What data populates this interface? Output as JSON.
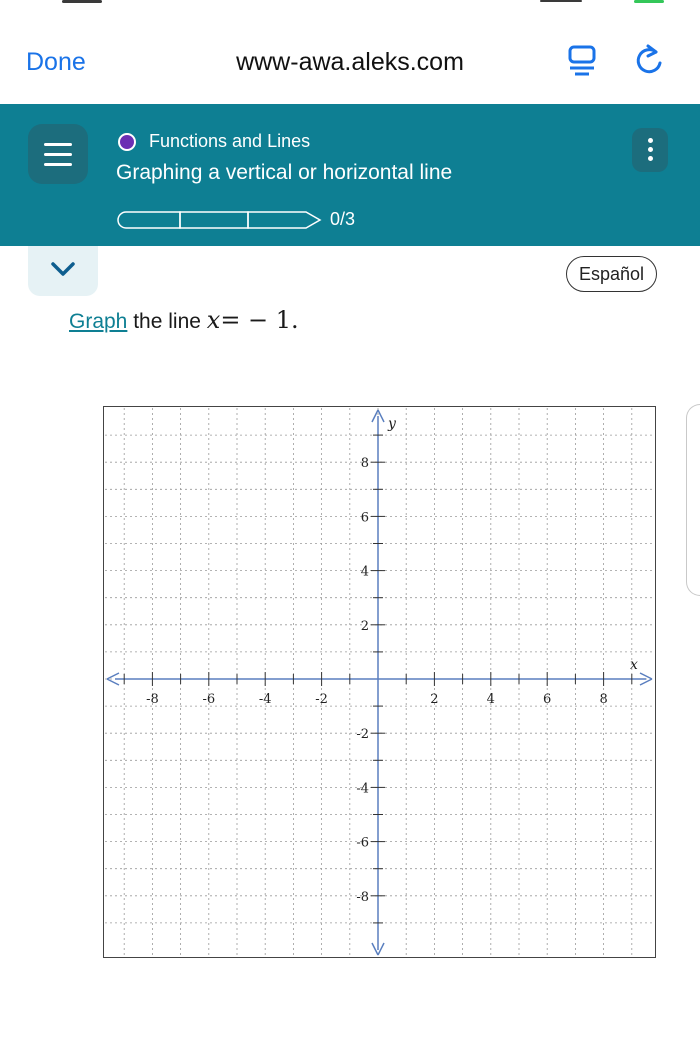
{
  "browser": {
    "done_label": "Done",
    "url": "www-awa.aleks.com",
    "reader_icon": "reader-mode-icon",
    "reload_icon": "reload-icon"
  },
  "header": {
    "topic": "Functions and Lines",
    "lesson": "Graphing a vertical or horizontal line",
    "progress_completed": 0,
    "progress_total": 3,
    "progress_text": "0/3",
    "topic_dot_color": "#6b2fb3",
    "background_color": "#0e7f93"
  },
  "controls": {
    "espanol_label": "Español"
  },
  "problem": {
    "link_word": "Graph",
    "rest_text": " the line ",
    "equation_var": "x",
    "equation_rest": "= − 1."
  },
  "chart_data": {
    "type": "scatter",
    "xlabel": "x",
    "ylabel": "y",
    "xlim": [
      -9.5,
      9.5
    ],
    "ylim": [
      -9.5,
      9.5
    ],
    "x_ticks": [
      "-8",
      "-6",
      "-4",
      "-2",
      "2",
      "4",
      "6",
      "8"
    ],
    "y_ticks": [
      "8",
      "6",
      "4",
      "2",
      "-2",
      "-4",
      "-6",
      "-8"
    ],
    "grid": true,
    "series": []
  }
}
